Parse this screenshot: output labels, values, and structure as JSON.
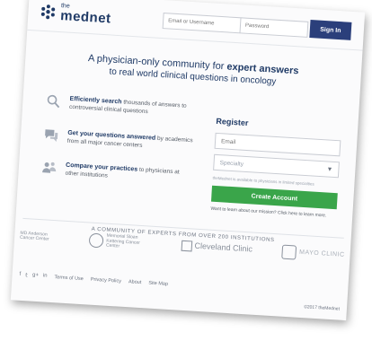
{
  "header": {
    "logo_prefix": "the",
    "logo_name": "mednet",
    "email_placeholder": "Email or Username",
    "password_placeholder": "Password",
    "signin_label": "Sign In"
  },
  "headline": {
    "line1_plain": "A physician-only community for ",
    "line1_bold": "expert answers",
    "line2": "to real world clinical questions in oncology"
  },
  "features": [
    {
      "icon": "search-icon",
      "bold": "Efficiently search",
      "rest": " thousands of answers to controversial clinical questions"
    },
    {
      "icon": "chat-icon",
      "bold": "Get your questions answered",
      "rest": " by academics from all major cancer centers"
    },
    {
      "icon": "people-icon",
      "bold": "Compare your practices",
      "rest": " to physicians at other institutions"
    }
  ],
  "register": {
    "title": "Register",
    "email_placeholder": "Email",
    "specialty_placeholder": "Specialty",
    "note": "theMednet is available to physicians in limited specialties",
    "create_label": "Create Account",
    "learn_more": "Want to learn about our mission? Click here to learn more."
  },
  "community_label": "A COMMUNITY OF EXPERTS FROM OVER 200 INSTITUTIONS",
  "partners": [
    {
      "name": "MD Anderson Cancer Center"
    },
    {
      "name": "Memorial Sloan Kettering Cancer Center"
    },
    {
      "name": "Cleveland Clinic"
    },
    {
      "name": "MAYO CLINIC"
    }
  ],
  "footer": {
    "social": [
      "f",
      "𝕥",
      "g+",
      "in"
    ],
    "links": [
      "Terms of Use",
      "Privacy Policy",
      "About",
      "Site Map"
    ],
    "copyright": "©2017 theMednet"
  },
  "colors": {
    "brand_navy": "#1f3a66",
    "signin_bg": "#2b3f7b",
    "create_green": "#3aa54a"
  }
}
